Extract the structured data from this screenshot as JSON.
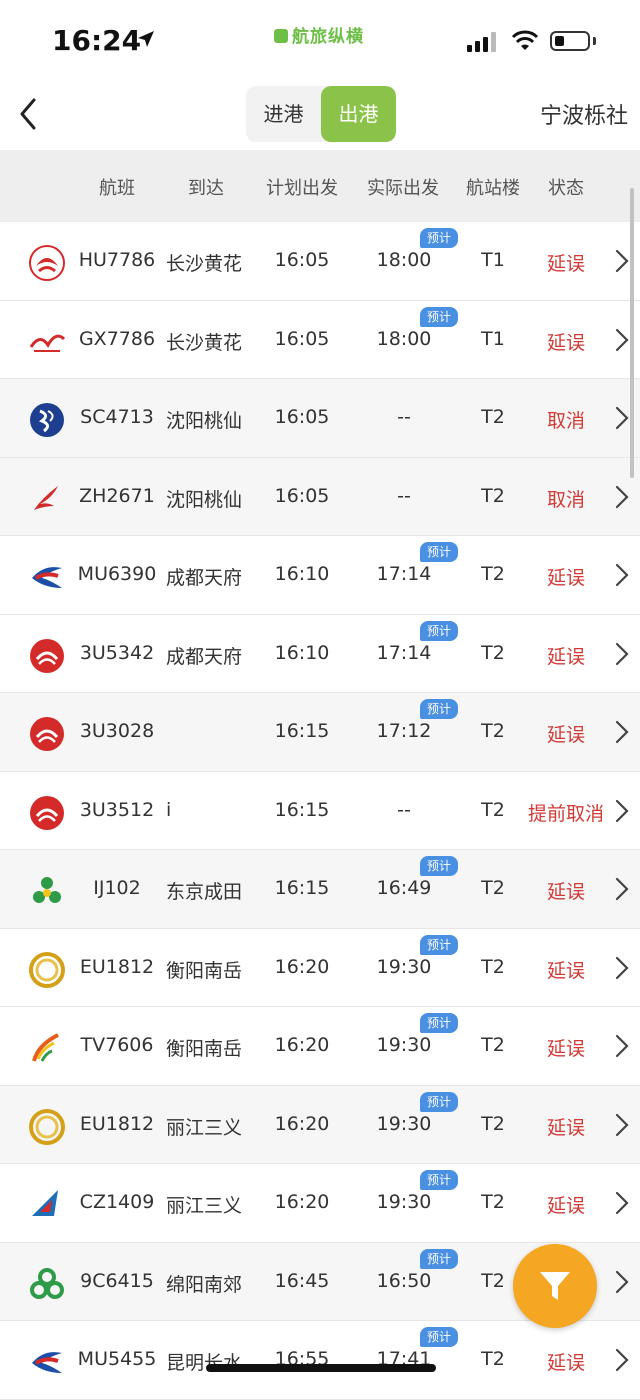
{
  "status_bar": {
    "time": "16:24",
    "brand": "航旅纵横"
  },
  "header": {
    "tabs": [
      {
        "label": "进港",
        "active": false
      },
      {
        "label": "出港",
        "active": true
      }
    ],
    "airport": "宁波栎社"
  },
  "columns": {
    "flight": "航班",
    "destination": "到达",
    "planned": "计划出发",
    "actual": "实际出发",
    "terminal": "航站楼",
    "status": "状态"
  },
  "est_label": "预计",
  "colors": {
    "accent": "#8bc34a",
    "delay": "#d23b35",
    "badge": "#4a90e2",
    "fab": "#f5a623"
  },
  "flights": [
    {
      "logo": "hainan-airlines",
      "flight": "HU7786",
      "dest": "长沙黄花",
      "planned": "16:05",
      "actual": "18:00",
      "est": true,
      "terminal": "T1",
      "status": "延误"
    },
    {
      "logo": "guangxi-airlines",
      "flight": "GX7786",
      "dest": "长沙黄花",
      "planned": "16:05",
      "actual": "18:00",
      "est": true,
      "terminal": "T1",
      "status": "延误"
    },
    {
      "logo": "shandong-airlines",
      "flight": "SC4713",
      "dest": "沈阳桃仙",
      "planned": "16:05",
      "actual": "--",
      "est": false,
      "terminal": "T2",
      "status": "取消"
    },
    {
      "logo": "shenzhen-airlines",
      "flight": "ZH2671",
      "dest": "沈阳桃仙",
      "planned": "16:05",
      "actual": "--",
      "est": false,
      "terminal": "T2",
      "status": "取消"
    },
    {
      "logo": "china-eastern",
      "flight": "MU6390",
      "dest": "成都天府",
      "planned": "16:10",
      "actual": "17:14",
      "est": true,
      "terminal": "T2",
      "status": "延误"
    },
    {
      "logo": "sichuan-airlines",
      "flight": "3U5342",
      "dest": "成都天府",
      "planned": "16:10",
      "actual": "17:14",
      "est": true,
      "terminal": "T2",
      "status": "延误"
    },
    {
      "logo": "sichuan-airlines",
      "flight": "3U3028",
      "dest": "",
      "planned": "16:15",
      "actual": "17:12",
      "est": true,
      "terminal": "T2",
      "status": "延误"
    },
    {
      "logo": "sichuan-airlines",
      "flight": "3U3512",
      "dest": "i",
      "planned": "16:15",
      "actual": "--",
      "est": false,
      "terminal": "T2",
      "status": "提前取消"
    },
    {
      "logo": "juneyao-airlines",
      "flight": "IJ102",
      "dest": "东京成田",
      "planned": "16:15",
      "actual": "16:49",
      "est": true,
      "terminal": "T2",
      "status": "延误"
    },
    {
      "logo": "lucky-air",
      "flight": "EU1812",
      "dest": "衡阳南岳",
      "planned": "16:20",
      "actual": "19:30",
      "est": true,
      "terminal": "T2",
      "status": "延误"
    },
    {
      "logo": "west-air",
      "flight": "TV7606",
      "dest": "衡阳南岳",
      "planned": "16:20",
      "actual": "19:30",
      "est": true,
      "terminal": "T2",
      "status": "延误"
    },
    {
      "logo": "lucky-air",
      "flight": "EU1812",
      "dest": "丽江三义",
      "planned": "16:20",
      "actual": "19:30",
      "est": true,
      "terminal": "T2",
      "status": "延误"
    },
    {
      "logo": "china-southern",
      "flight": "CZ1409",
      "dest": "丽江三义",
      "planned": "16:20",
      "actual": "19:30",
      "est": true,
      "terminal": "T2",
      "status": "延误"
    },
    {
      "logo": "spring-airlines",
      "flight": "9C6415",
      "dest": "绵阳南郊",
      "planned": "16:45",
      "actual": "16:50",
      "est": true,
      "terminal": "T2",
      "status": ""
    },
    {
      "logo": "china-eastern",
      "flight": "MU5455",
      "dest": "昆明长水",
      "planned": "16:55",
      "actual": "17:41",
      "est": true,
      "terminal": "T2",
      "status": "延误"
    }
  ]
}
